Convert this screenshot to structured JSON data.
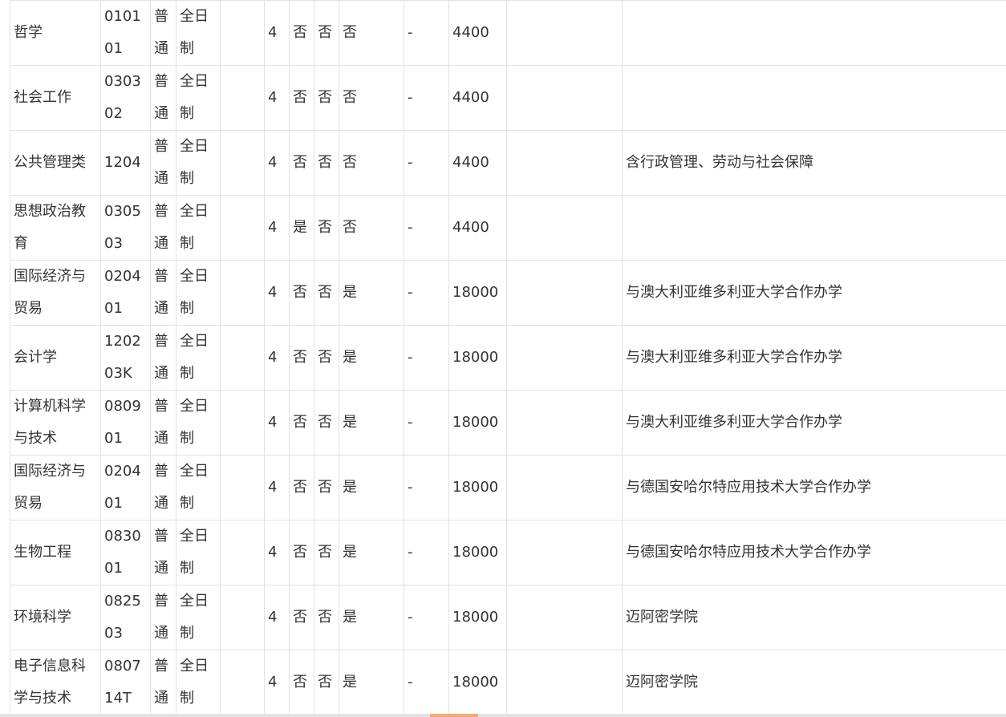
{
  "rows": [
    {
      "name": "哲学",
      "code": "010101",
      "type": "普通",
      "form": "全日制",
      "blank": "",
      "years": "4",
      "col_a": "否",
      "col_b": "否",
      "col_c": "否",
      "dash": "-",
      "fee": "4400",
      "empty": "",
      "note": ""
    },
    {
      "name": "社会工作",
      "code": "030302",
      "type": "普通",
      "form": "全日制",
      "blank": "",
      "years": "4",
      "col_a": "否",
      "col_b": "否",
      "col_c": "否",
      "dash": "-",
      "fee": "4400",
      "empty": "",
      "note": ""
    },
    {
      "name": "公共管理类",
      "code": "1204",
      "type": "普通",
      "form": "全日制",
      "blank": "",
      "years": "4",
      "col_a": "否",
      "col_b": "否",
      "col_c": "否",
      "dash": "-",
      "fee": "4400",
      "empty": "",
      "note": "含行政管理、劳动与社会保障"
    },
    {
      "name": "思想政治教育",
      "code": "030503",
      "type": "普通",
      "form": "全日制",
      "blank": "",
      "years": "4",
      "col_a": "是",
      "col_b": "否",
      "col_c": "否",
      "dash": "-",
      "fee": "4400",
      "empty": "",
      "note": ""
    },
    {
      "name": "国际经济与贸易",
      "code": "020401",
      "type": "普通",
      "form": "全日制",
      "blank": "",
      "years": "4",
      "col_a": "否",
      "col_b": "否",
      "col_c": "是",
      "dash": "-",
      "fee": "18000",
      "empty": "",
      "note": "与澳大利亚维多利亚大学合作办学"
    },
    {
      "name": "会计学",
      "code": "120203K",
      "type": "普通",
      "form": "全日制",
      "blank": "",
      "years": "4",
      "col_a": "否",
      "col_b": "否",
      "col_c": "是",
      "dash": "-",
      "fee": "18000",
      "empty": "",
      "note": "与澳大利亚维多利亚大学合作办学"
    },
    {
      "name": "计算机科学与技术",
      "code": "080901",
      "type": "普通",
      "form": "全日制",
      "blank": "",
      "years": "4",
      "col_a": "否",
      "col_b": "否",
      "col_c": "是",
      "dash": "-",
      "fee": "18000",
      "empty": "",
      "note": "与澳大利亚维多利亚大学合作办学"
    },
    {
      "name": "国际经济与贸易",
      "code": "020401",
      "type": "普通",
      "form": "全日制",
      "blank": "",
      "years": "4",
      "col_a": "否",
      "col_b": "否",
      "col_c": "是",
      "dash": "-",
      "fee": "18000",
      "empty": "",
      "note": "与德国安哈尔特应用技术大学合作办学"
    },
    {
      "name": "生物工程",
      "code": "083001",
      "type": "普通",
      "form": "全日制",
      "blank": "",
      "years": "4",
      "col_a": "否",
      "col_b": "否",
      "col_c": "是",
      "dash": "-",
      "fee": "18000",
      "empty": "",
      "note": "与德国安哈尔特应用技术大学合作办学"
    },
    {
      "name": "环境科学",
      "code": "082503",
      "type": "普通",
      "form": "全日制",
      "blank": "",
      "years": "4",
      "col_a": "否",
      "col_b": "否",
      "col_c": "是",
      "dash": "-",
      "fee": "18000",
      "empty": "",
      "note": "迈阿密学院"
    },
    {
      "name": "电子信息科学与技术",
      "code": "080714T",
      "type": "普通",
      "form": "全日制",
      "blank": "",
      "years": "4",
      "col_a": "否",
      "col_b": "否",
      "col_c": "是",
      "dash": "-",
      "fee": "18000",
      "empty": "",
      "note": "迈阿密学院"
    }
  ],
  "colors": {
    "text": "#333333",
    "border": "#e2e2e2",
    "scrollbar_track": "#e3e3e3",
    "scrollbar_thumb": "#f5a97a"
  }
}
